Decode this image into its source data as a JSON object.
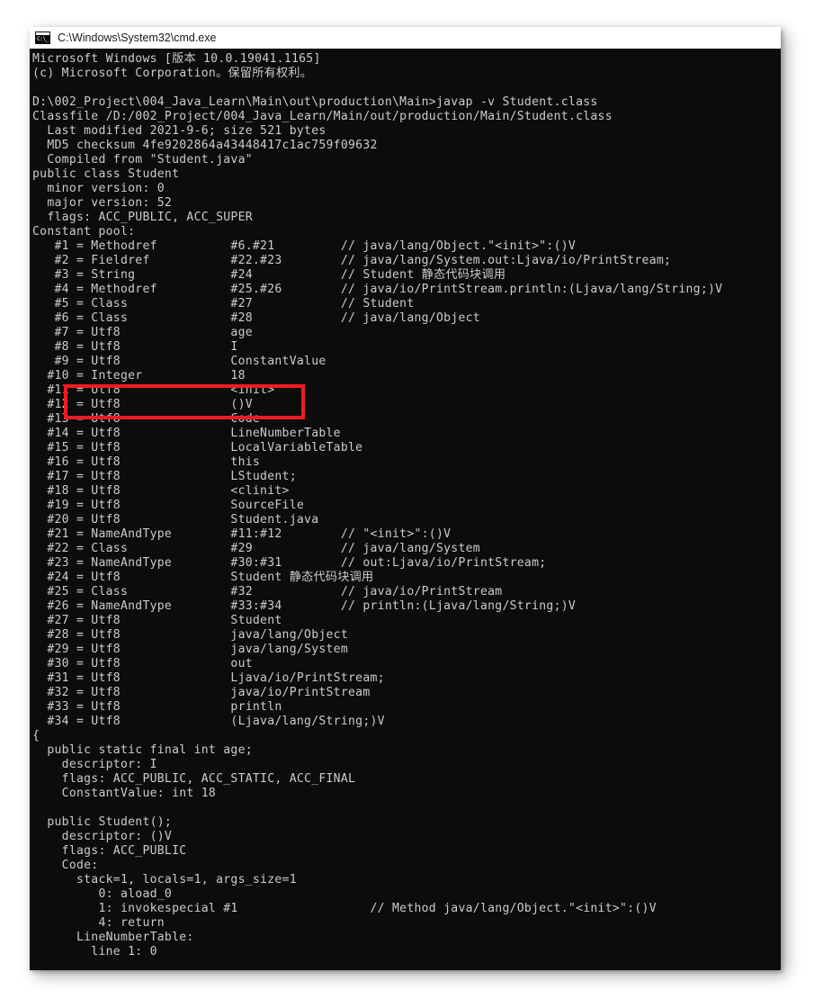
{
  "window": {
    "title": "C:\\Windows\\System32\\cmd.exe",
    "icon": "cmd-console-icon",
    "icon_glyph": "C:\\_",
    "background_color": "#0c0c0c",
    "text_color": "#cccccc",
    "titlebar_color": "#ffffff"
  },
  "annotation": {
    "type": "rectangle",
    "color": "#ef1c22",
    "targets_lines": [
      "#9 = Utf8  ConstantValue",
      "#10 = Integer  18",
      "#11 = Utf8  <init>"
    ]
  },
  "terminal": {
    "lines": [
      "Microsoft Windows [版本 10.0.19041.1165]",
      "(c) Microsoft Corporation。保留所有权利。",
      "",
      "D:\\002_Project\\004_Java_Learn\\Main\\out\\production\\Main>javap -v Student.class",
      "Classfile /D:/002_Project/004_Java_Learn/Main/out/production/Main/Student.class",
      "  Last modified 2021-9-6; size 521 bytes",
      "  MD5 checksum 4fe9202864a43448417c1ac759f09632",
      "  Compiled from \"Student.java\"",
      "public class Student",
      "  minor version: 0",
      "  major version: 52",
      "  flags: ACC_PUBLIC, ACC_SUPER",
      "Constant pool:",
      "   #1 = Methodref          #6.#21         // java/lang/Object.\"<init>\":()V",
      "   #2 = Fieldref           #22.#23        // java/lang/System.out:Ljava/io/PrintStream;",
      "   #3 = String             #24            // Student 静态代码块调用",
      "   #4 = Methodref          #25.#26        // java/io/PrintStream.println:(Ljava/lang/String;)V",
      "   #5 = Class              #27            // Student",
      "   #6 = Class              #28            // java/lang/Object",
      "   #7 = Utf8               age",
      "   #8 = Utf8               I",
      "   #9 = Utf8               ConstantValue",
      "  #10 = Integer            18",
      "  #11 = Utf8               <init>",
      "  #12 = Utf8               ()V",
      "  #13 = Utf8               Code",
      "  #14 = Utf8               LineNumberTable",
      "  #15 = Utf8               LocalVariableTable",
      "  #16 = Utf8               this",
      "  #17 = Utf8               LStudent;",
      "  #18 = Utf8               <clinit>",
      "  #19 = Utf8               SourceFile",
      "  #20 = Utf8               Student.java",
      "  #21 = NameAndType        #11:#12        // \"<init>\":()V",
      "  #22 = Class              #29            // java/lang/System",
      "  #23 = NameAndType        #30:#31        // out:Ljava/io/PrintStream;",
      "  #24 = Utf8               Student 静态代码块调用",
      "  #25 = Class              #32            // java/io/PrintStream",
      "  #26 = NameAndType        #33:#34        // println:(Ljava/lang/String;)V",
      "  #27 = Utf8               Student",
      "  #28 = Utf8               java/lang/Object",
      "  #29 = Utf8               java/lang/System",
      "  #30 = Utf8               out",
      "  #31 = Utf8               Ljava/io/PrintStream;",
      "  #32 = Utf8               java/io/PrintStream",
      "  #33 = Utf8               println",
      "  #34 = Utf8               (Ljava/lang/String;)V",
      "{",
      "  public static final int age;",
      "    descriptor: I",
      "    flags: ACC_PUBLIC, ACC_STATIC, ACC_FINAL",
      "    ConstantValue: int 18",
      "",
      "  public Student();",
      "    descriptor: ()V",
      "    flags: ACC_PUBLIC",
      "    Code:",
      "      stack=1, locals=1, args_size=1",
      "         0: aload_0",
      "         1: invokespecial #1                  // Method java/lang/Object.\"<init>\":()V",
      "         4: return",
      "      LineNumberTable:",
      "        line 1: 0"
    ]
  }
}
